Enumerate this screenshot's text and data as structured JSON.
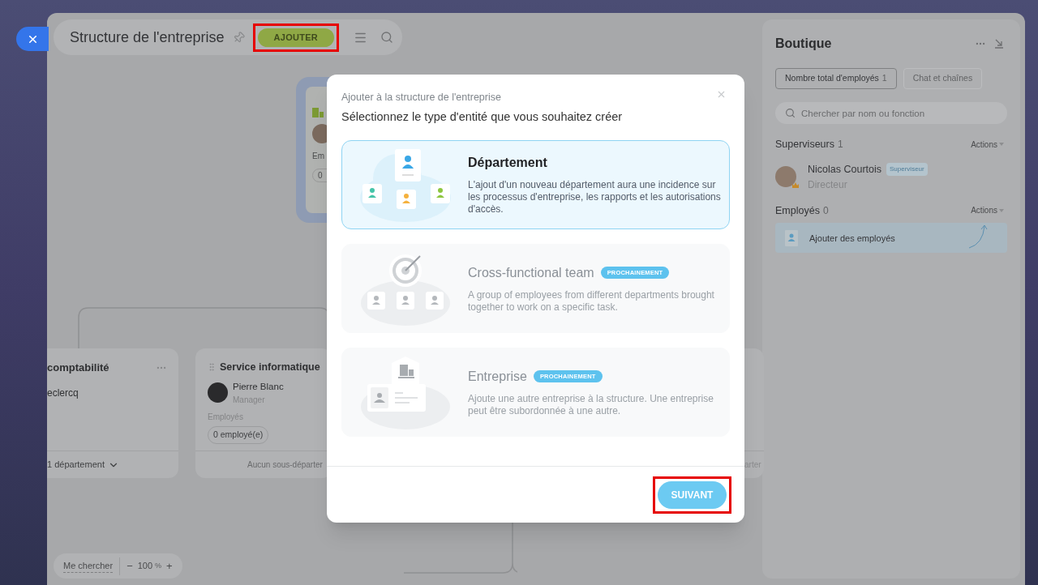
{
  "header": {
    "title": "Structure de l'entreprise",
    "add_button": {
      "label": "AJOUTER",
      "highlighted": true
    }
  },
  "org_chart": {
    "top_card": {
      "label_fragment": "Em",
      "count_fragment": "0"
    },
    "cards": [
      {
        "title": "comptabilité",
        "person": "eclercq",
        "footer": "1 département",
        "expandable": true
      },
      {
        "title": "Service informatique",
        "person": "Pierre Blanc",
        "role": "Manager",
        "employees_label": "Employés",
        "employees_count": "0 employé(e)",
        "footer": "Aucun sous-départer",
        "expandable": false
      }
    ],
    "edge_card_fragment": "arter"
  },
  "zoom_bar": {
    "find_me": "Me chercher",
    "minus": "−",
    "value": "100",
    "unit": "%",
    "plus": "+"
  },
  "side_panel": {
    "title": "Boutique",
    "tabs": [
      {
        "label": "Nombre total d'employés",
        "count": "1",
        "selected": true
      },
      {
        "label": "Chat et chaînes",
        "selected": false
      }
    ],
    "search": {
      "placeholder": "Chercher par nom ou fonction"
    },
    "supervisors": {
      "heading": "Superviseurs",
      "count": "1",
      "actions": "Actions",
      "people": [
        {
          "name": "Nicolas Courtois",
          "badge": "Superviseur",
          "role": "Directeur"
        }
      ]
    },
    "employees": {
      "heading": "Employés",
      "count": "0",
      "actions": "Actions",
      "add_label": "Ajouter des employés"
    }
  },
  "dialog": {
    "subtitle": "Ajouter à la structure de l'entreprise",
    "title": "Sélectionnez le type d'entité que vous souhaitez créer",
    "options": [
      {
        "kind": "department",
        "title": "Département",
        "description": "L'ajout d'un nouveau département aura une incidence sur les processus d'entreprise, les rapports et les autorisations d'accès.",
        "selected": true,
        "disabled": false
      },
      {
        "kind": "team",
        "title": "Cross-functional team",
        "badge": "PROCHAINEMENT",
        "description": "A group of employees from different departments brought together to work on a specific task.",
        "selected": false,
        "disabled": true
      },
      {
        "kind": "company",
        "title": "Entreprise",
        "badge": "PROCHAINEMENT",
        "description": "Ajoute une autre entreprise à la structure. Une entreprise peut être subordonnée à une autre.",
        "selected": false,
        "disabled": true
      }
    ],
    "next_button": {
      "label": "SUIVANT",
      "highlighted": true
    }
  }
}
